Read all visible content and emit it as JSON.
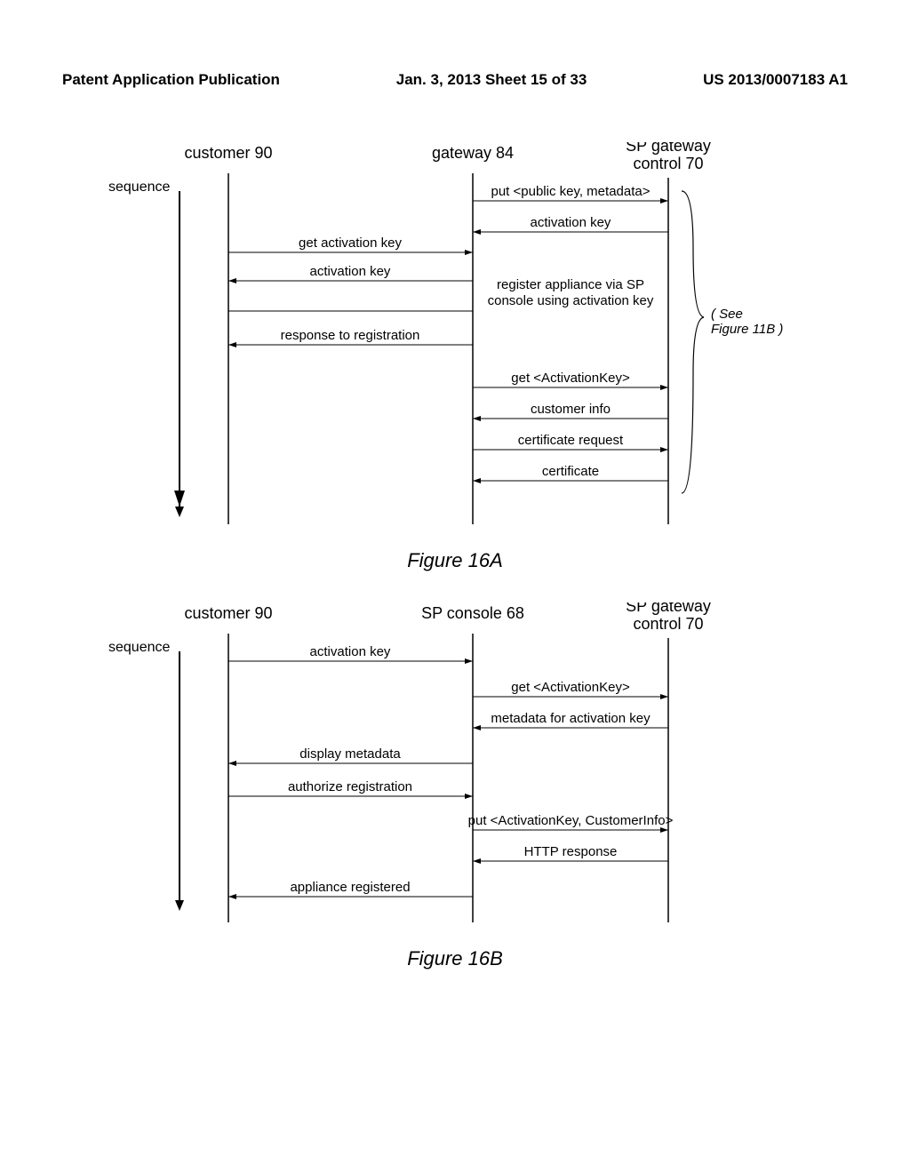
{
  "header": {
    "left": "Patent Application Publication",
    "center": "Jan. 3, 2013   Sheet 15 of 33",
    "right": "US 2013/0007183 A1"
  },
  "figA": {
    "actors": {
      "customer": "customer 90",
      "gateway": "gateway 84",
      "spgw": "SP gateway\ncontrol 70"
    },
    "sequence_label": "sequence",
    "side_note": "( See\nFigure 11B )",
    "caption": "Figure 16A",
    "messages": {
      "m1": "put <public key, metadata>",
      "m2": "activation key",
      "m3": "get activation key",
      "m4": "activation key",
      "m5a": "register appliance via SP",
      "m5b": "console using activation key",
      "m6": "response to registration",
      "m7": "get <ActivationKey>",
      "m8": "customer info",
      "m9": "certificate request",
      "m10": "certificate"
    }
  },
  "figB": {
    "actors": {
      "customer": "customer 90",
      "console": "SP console 68",
      "spgw": "SP gateway\ncontrol 70"
    },
    "sequence_label": "sequence",
    "caption": "Figure 16B",
    "messages": {
      "m1": "activation key",
      "m2": "get <ActivationKey>",
      "m3": "metadata for activation key",
      "m4": "display metadata",
      "m5": "authorize registration",
      "m6": "put <ActivationKey, CustomerInfo>",
      "m7": "HTTP response",
      "m8": "appliance registered"
    }
  }
}
